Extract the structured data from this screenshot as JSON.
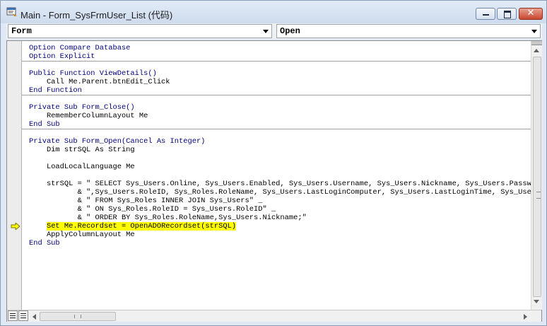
{
  "window": {
    "title": "Main - Form_SysFrmUser_List (代码)",
    "controls": {
      "minimize": "minimize",
      "maximize": "maximize",
      "close": "✕"
    }
  },
  "object_combo": {
    "value": "Form"
  },
  "procedure_combo": {
    "value": "Open"
  },
  "code": {
    "lines": [
      "Option Compare Database",
      "Option Explicit",
      "Public Function ViewDetails()",
      "    Call Me.Parent.btnEdit_Click",
      "End Function",
      "Private Sub Form_Close()",
      "    RememberColumnLayout Me",
      "End Sub",
      "Private Sub Form_Open(Cancel As Integer)",
      "    Dim strSQL As String",
      "    LoadLocalLanguage Me",
      "    strSQL = \" SELECT Sys_Users.Online, Sys_Users.Enabled, Sys_Users.Username, Sys_Users.Nickname, Sys_Users.Password\" _",
      "           & \",Sys_Users.RoleID, Sys_Roles.RoleName, Sys_Users.LastLoginComputer, Sys_Users.LastLoginTime, Sys_Users.Note\" _",
      "           & \" FROM Sys_Roles INNER JOIN Sys_Users\" _",
      "           & \" ON Sys_Roles.RoleID = Sys_Users.RoleID\" _",
      "           & \" ORDER BY Sys_Roles.RoleName,Sys_Users.Nickname;\"",
      "    Set Me.Recordset = OpenADORecordset(strSQL)",
      "    ApplyColumnLayout Me",
      "End Sub"
    ],
    "current_line": 16
  },
  "colors": {
    "highlight": "#ffff00",
    "keyword": "#00007f",
    "arrow": "#ffff00"
  },
  "icons": [
    "vba-module-icon",
    "execution-arrow-icon",
    "procedure-view-icon",
    "full-module-view-icon"
  ]
}
